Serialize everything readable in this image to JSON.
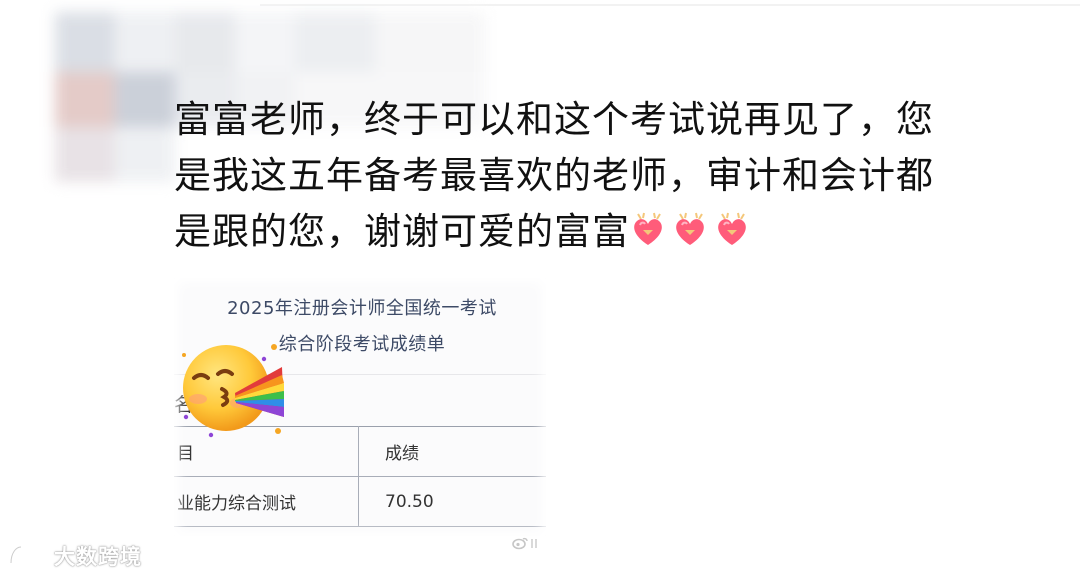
{
  "post": {
    "comment_lines": [
      "富富老师，终于可以和这个考试说再见了，您",
      "是我这五年备考最喜欢的老师，审计和会计都",
      "是跟的您，谢谢可爱的富富"
    ],
    "trailing_emoji": "heart-with-ribbon-icon",
    "trailing_emoji_count": 3
  },
  "attachment": {
    "title_line1": "2025年注册会计师全国统一考试",
    "title_line2": "综合阶段考试成绩单",
    "name_label_fragment": "名",
    "table": {
      "headers": [
        "目",
        "成绩"
      ],
      "rows": [
        [
          "业能力综合测试",
          "70.50"
        ]
      ]
    },
    "overlay_emoji": "kissing-face-rainbow-icon",
    "watermark_icon": "weibo-logo-icon"
  },
  "watermark": {
    "text": "大数跨境",
    "icon": "brand-logo-icon",
    "text_color": "#ffffff"
  },
  "colors": {
    "comment_text": "#111111",
    "card_title": "#3d4a66",
    "heart": "#ff5c7a",
    "ribbon": "#f4c77a"
  }
}
